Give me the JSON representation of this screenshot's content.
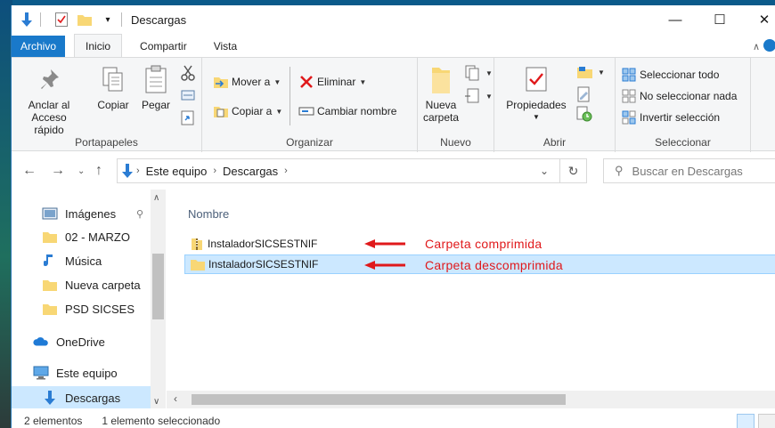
{
  "window": {
    "title": "Descargas",
    "minimize_glyph": "—",
    "maximize_glyph": "☐",
    "close_glyph": "✕"
  },
  "tabs": [
    {
      "label": "Archivo"
    },
    {
      "label": "Inicio"
    },
    {
      "label": "Compartir"
    },
    {
      "label": "Vista"
    }
  ],
  "ribbon": {
    "portapapeles": {
      "label": "Portapapeles",
      "pin_label_1": "Anclar al",
      "pin_label_2": "Acceso rápido",
      "copy": "Copiar",
      "paste": "Pegar"
    },
    "organizar": {
      "label": "Organizar",
      "move": "Mover a",
      "copy_to": "Copiar a",
      "delete": "Eliminar",
      "rename": "Cambiar nombre"
    },
    "nuevo": {
      "label": "Nuevo",
      "new_folder_1": "Nueva",
      "new_folder_2": "carpeta"
    },
    "abrir": {
      "label": "Abrir",
      "properties": "Propiedades"
    },
    "seleccionar": {
      "label": "Seleccionar",
      "select_all": "Seleccionar todo",
      "select_none": "No seleccionar nada",
      "invert": "Invertir selección"
    }
  },
  "address": {
    "crumbs": [
      "Este equipo",
      "Descargas"
    ],
    "search_placeholder": "Buscar en Descargas"
  },
  "nav": {
    "items": [
      {
        "label": "Imágenes",
        "icon": "pictures-icon"
      },
      {
        "label": "02 - MARZO",
        "icon": "folder-icon"
      },
      {
        "label": "Música",
        "icon": "music-icon"
      },
      {
        "label": "Nueva carpeta",
        "icon": "folder-icon"
      },
      {
        "label": "PSD SICSES",
        "icon": "folder-icon"
      },
      {
        "label": "OneDrive",
        "icon": "onedrive-icon"
      },
      {
        "label": "Este equipo",
        "icon": "computer-icon"
      },
      {
        "label": "Descargas",
        "icon": "downloads-icon"
      }
    ]
  },
  "content": {
    "column_header": "Nombre",
    "files": [
      {
        "name": "InstaladorSICSESTNIF",
        "type": "zip",
        "selected": false,
        "annotation": "Carpeta comprimida"
      },
      {
        "name": "InstaladorSICSESTNIF",
        "type": "folder",
        "selected": true,
        "annotation": "Carpeta descomprimida"
      }
    ],
    "annotation_color": "#e0191b"
  },
  "status": {
    "count": "2 elementos",
    "selection": "1 elemento seleccionado"
  },
  "colors": {
    "accent": "#1979ca",
    "selection": "#cce8ff",
    "folder": "#f8d775"
  }
}
